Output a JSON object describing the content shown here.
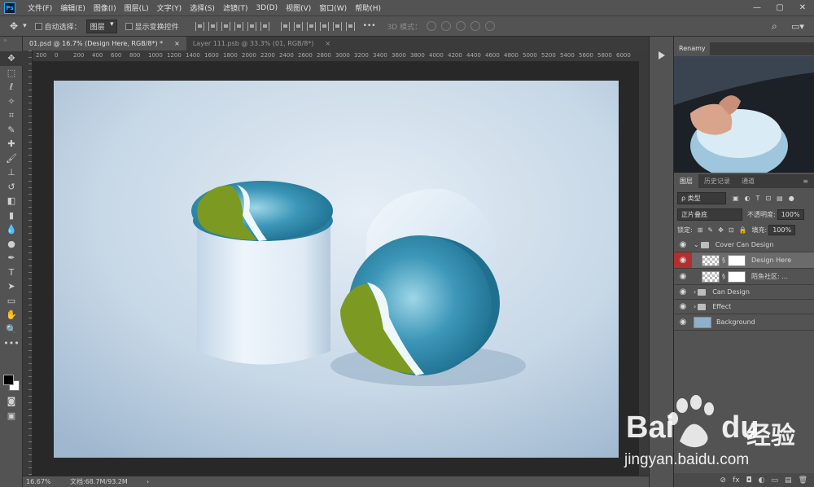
{
  "app": {
    "logo": "Ps"
  },
  "menu": [
    "文件(F)",
    "编辑(E)",
    "图像(I)",
    "图层(L)",
    "文字(Y)",
    "选择(S)",
    "滤镜(T)",
    "3D(D)",
    "视图(V)",
    "窗口(W)",
    "帮助(H)"
  ],
  "options": {
    "auto_select_label": "自动选择：",
    "auto_select_value": "图层",
    "show_transform_label": "显示变换控件",
    "mode3d_label": "3D 模式："
  },
  "tabs": [
    {
      "label": "01.psd @ 16.7% (Design Here, RGB/8*) *",
      "close": "×"
    },
    {
      "label": "Layer 111.psb @ 33.3% (01, RGB/8*)",
      "close": "×"
    }
  ],
  "ruler_top": [
    "200",
    "0",
    "200",
    "400",
    "600",
    "800",
    "1000",
    "1200",
    "1400",
    "1600",
    "1800",
    "2000",
    "2200",
    "2400",
    "2600",
    "2800",
    "3000",
    "3200",
    "3400",
    "3600",
    "3800",
    "4000",
    "4200",
    "4400",
    "4600",
    "4800",
    "5000",
    "5200",
    "5400",
    "5600",
    "5800",
    "6000"
  ],
  "status": {
    "zoom": "16.67%",
    "doc": "文档:68.7M/93.2M",
    "arrow": "›"
  },
  "right_panel": {
    "top_tab": "Renamy",
    "layer_tabs": [
      "图层",
      "历史记录",
      "通道"
    ],
    "filter_label": "ρ 类型",
    "blend_mode": "正片叠底",
    "opacity_label": "不透明度:",
    "opacity_value": "100%",
    "lock_label": "锁定:",
    "fill_label": "填充:",
    "fill_value": "100%",
    "layers": [
      {
        "name": "Cover Can Design",
        "kind": "group-open"
      },
      {
        "name": "Design Here",
        "kind": "smart",
        "selected": true
      },
      {
        "name": "陌鱼社区: ...",
        "kind": "smart"
      },
      {
        "name": "Can Design",
        "kind": "group"
      },
      {
        "name": "Effect",
        "kind": "group"
      },
      {
        "name": "Background",
        "kind": "image"
      }
    ],
    "bottom_icons": [
      "⊘",
      "fx",
      "◘",
      "◐",
      "▭",
      "▤",
      "🗑"
    ]
  },
  "watermark": {
    "brand": "Bai",
    "brand2": "du",
    "product": "经验",
    "url": "jingyan.baidu.com"
  },
  "colors": {
    "ui": "#535353",
    "dark": "#3b3b3b",
    "canvas_bg": "#282828",
    "eye_red": "#b03030"
  }
}
